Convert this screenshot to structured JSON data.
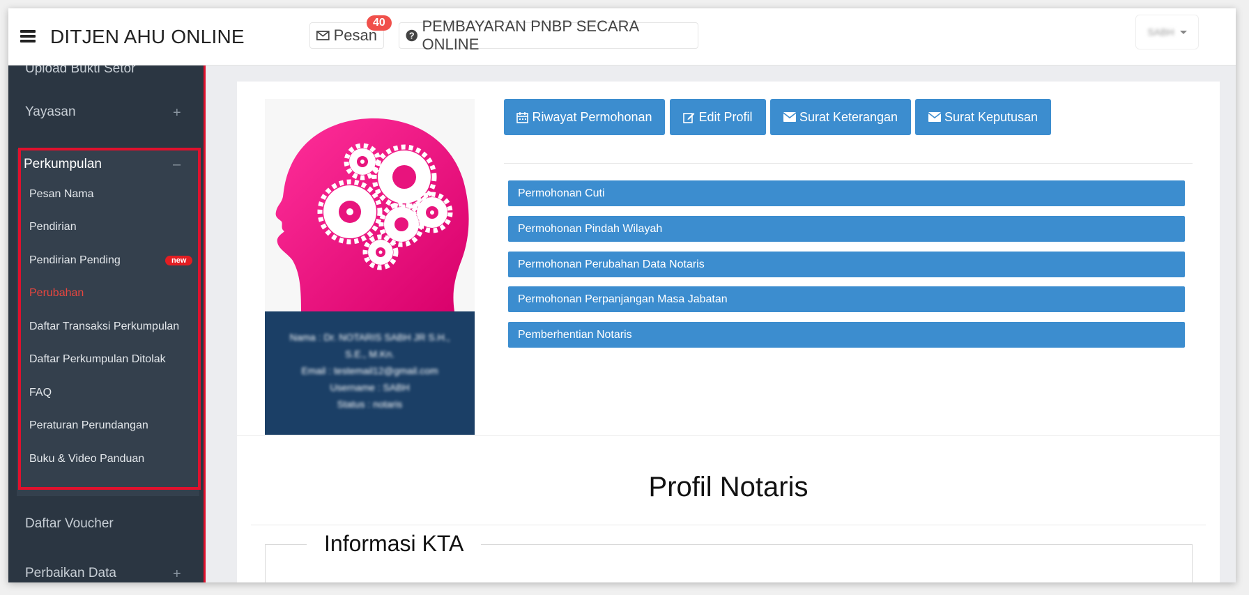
{
  "header": {
    "app_title": "DITJEN AHU ONLINE",
    "messages_label": "Pesan",
    "messages_count": "40",
    "payment_label": "PEMBAYARAN PNBP SECARA ONLINE",
    "user_name": "SABH"
  },
  "sidebar": {
    "top_items": [
      {
        "label": "Upload Bukti Setor"
      },
      {
        "label": "Yayasan",
        "expander": "+"
      }
    ],
    "group": {
      "label": "Perkumpulan",
      "expander": "–",
      "items": [
        {
          "label": "Pesan Nama"
        },
        {
          "label": "Pendirian"
        },
        {
          "label": "Pendirian Pending",
          "badge": "new"
        },
        {
          "label": "Perubahan",
          "active": true
        },
        {
          "label": "Daftar Transaksi Perkumpulan"
        },
        {
          "label": "Daftar Perkumpulan Ditolak"
        },
        {
          "label": "FAQ"
        },
        {
          "label": "Peraturan Perundangan"
        },
        {
          "label": "Buku & Video Panduan"
        }
      ]
    },
    "bottom_items": [
      {
        "label": "Daftar Voucher"
      },
      {
        "label": "Perbaikan Data",
        "expander": "+"
      }
    ]
  },
  "profile": {
    "info_lines": [
      "Nama : Dr. NOTARIS SABH JR S.H.,",
      "S.E., M.Kn.",
      "Email : testemail12@gmail.com",
      "Username : SABH",
      "Status : notaris"
    ]
  },
  "actions": [
    {
      "label": "Riwayat Permohonan",
      "icon": "calendar-icon"
    },
    {
      "label": "Edit Profil",
      "icon": "edit-icon"
    },
    {
      "label": "Surat Keterangan",
      "icon": "envelope-icon"
    },
    {
      "label": "Surat Keputusan",
      "icon": "envelope-icon"
    }
  ],
  "requests": [
    "Permohonan Cuti",
    "Permohonan Pindah Wilayah",
    "Permohonan Perubahan Data Notaris",
    "Permohonan Perpanjangan Masa Jabatan",
    "Pemberhentian Notaris"
  ],
  "main": {
    "page_title": "Profil Notaris",
    "section_title": "Informasi KTA"
  },
  "colors": {
    "accent": "#3c8dcf",
    "sidebar": "#2b3642",
    "highlight": "#e0112d",
    "badge": "#f0504b"
  }
}
